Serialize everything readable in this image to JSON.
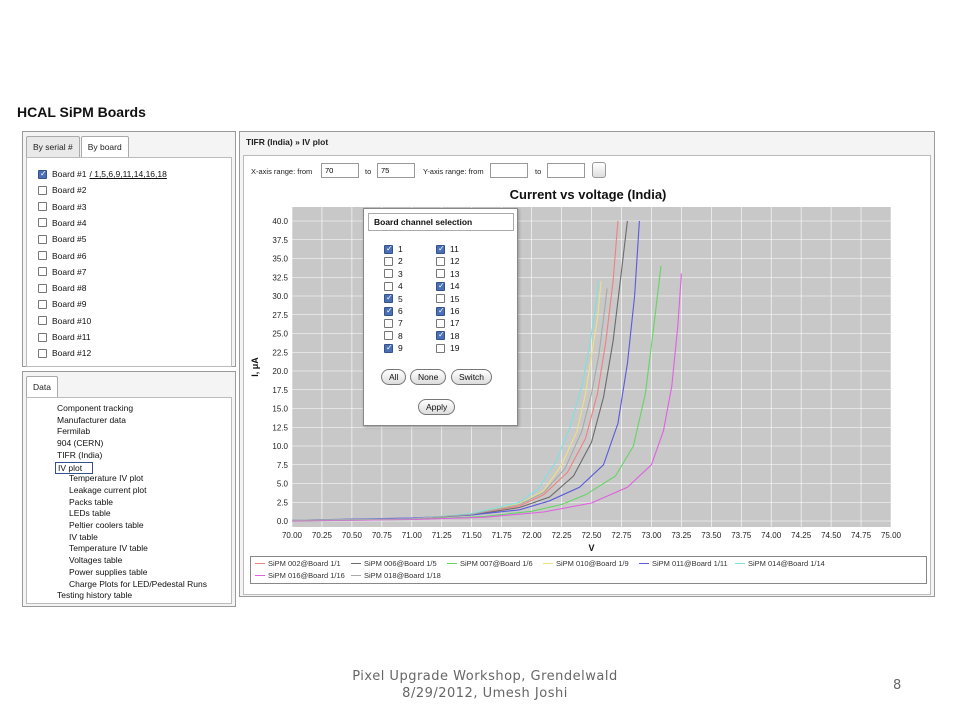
{
  "slide": {
    "title": "HCAL SiPM Boards",
    "footer_line1": "Pixel Upgrade Workshop, Grendelwald",
    "footer_line2": "8/29/2012, Umesh Joshi",
    "page_number": "8"
  },
  "left_top": {
    "tabs": [
      "By serial #",
      "By board"
    ],
    "boards": [
      {
        "label": "Board #1",
        "link": "/ 1,5,6,9,11,14,16,18",
        "checked": true
      },
      {
        "label": "Board #2",
        "checked": false
      },
      {
        "label": "Board #3",
        "checked": false
      },
      {
        "label": "Board #4",
        "checked": false
      },
      {
        "label": "Board #5",
        "checked": false
      },
      {
        "label": "Board #6",
        "checked": false
      },
      {
        "label": "Board #7",
        "checked": false
      },
      {
        "label": "Board #8",
        "checked": false
      },
      {
        "label": "Board #9",
        "checked": false
      },
      {
        "label": "Board #10",
        "checked": false
      },
      {
        "label": "Board #11",
        "checked": false
      },
      {
        "label": "Board #12",
        "checked": false
      }
    ]
  },
  "left_bottom": {
    "tab": "Data",
    "tree": [
      {
        "label": "Component tracking",
        "level": 0
      },
      {
        "label": "Manufacturer data",
        "level": 0
      },
      {
        "label": "Fermilab",
        "level": 0
      },
      {
        "label": "904 (CERN)",
        "level": 0
      },
      {
        "label": "TIFR (India)",
        "level": 0
      },
      {
        "label": "IV plot",
        "level": 1,
        "selected": true
      },
      {
        "label": "Temperature IV plot",
        "level": 1
      },
      {
        "label": "Leakage current plot",
        "level": 1
      },
      {
        "label": "Packs table",
        "level": 1
      },
      {
        "label": "LEDs table",
        "level": 1
      },
      {
        "label": "Peltier coolers table",
        "level": 1
      },
      {
        "label": "IV table",
        "level": 1
      },
      {
        "label": "Temperature IV table",
        "level": 1
      },
      {
        "label": "Voltages table",
        "level": 1
      },
      {
        "label": "Power supplies table",
        "level": 1
      },
      {
        "label": "Charge Plots for LED/Pedestal Runs",
        "level": 1
      },
      {
        "label": "Testing history table",
        "level": 0
      }
    ]
  },
  "right": {
    "breadcrumb": "TIFR (India) »  IV plot",
    "x_range_label": "X-axis range: from",
    "x_from": "70",
    "to_label": "to",
    "x_to": "75",
    "y_range_label": "Y-axis range: from",
    "y_from": "",
    "y_to": ""
  },
  "popup": {
    "title": "Board channel selection",
    "channels": [
      {
        "n": "1",
        "on": true
      },
      {
        "n": "2",
        "on": false
      },
      {
        "n": "3",
        "on": false
      },
      {
        "n": "4",
        "on": false
      },
      {
        "n": "5",
        "on": true
      },
      {
        "n": "6",
        "on": true
      },
      {
        "n": "7",
        "on": false
      },
      {
        "n": "8",
        "on": false
      },
      {
        "n": "9",
        "on": true
      },
      {
        "n": "11",
        "on": true
      },
      {
        "n": "12",
        "on": false
      },
      {
        "n": "13",
        "on": false
      },
      {
        "n": "14",
        "on": true
      },
      {
        "n": "15",
        "on": false
      },
      {
        "n": "16",
        "on": true
      },
      {
        "n": "17",
        "on": false
      },
      {
        "n": "18",
        "on": true
      },
      {
        "n": "19",
        "on": false
      }
    ],
    "buttons": [
      "All",
      "None",
      "Switch"
    ],
    "apply": "Apply"
  },
  "chart_data": {
    "type": "line",
    "title": "Current vs voltage (India)",
    "xlabel": "V",
    "ylabel": "I, μA",
    "xlim": [
      70.0,
      75.0
    ],
    "ylim": [
      0.0,
      40.0
    ],
    "x_ticks": [
      "70.00",
      "70.25",
      "70.50",
      "70.75",
      "71.00",
      "71.25",
      "71.50",
      "71.75",
      "72.00",
      "72.25",
      "72.50",
      "72.75",
      "73.00",
      "73.25",
      "73.50",
      "73.75",
      "74.00",
      "74.25",
      "74.50",
      "74.75",
      "75.00"
    ],
    "y_ticks": [
      "0.0",
      "2.5",
      "5.0",
      "7.5",
      "10.0",
      "12.5",
      "15.0",
      "17.5",
      "20.0",
      "22.5",
      "25.0",
      "27.5",
      "30.0",
      "32.5",
      "35.0",
      "37.5",
      "40.0"
    ],
    "grid": true,
    "legend_position": "bottom",
    "series": [
      {
        "name": "SiPM 002@Board 1/1",
        "color": "#f08080",
        "x": [
          70.0,
          71.0,
          71.5,
          71.9,
          72.1,
          72.3,
          72.45,
          72.55,
          72.62,
          72.68,
          72.72
        ],
        "y": [
          0.1,
          0.3,
          0.9,
          2.0,
          3.5,
          6.5,
          11.0,
          17.0,
          24.0,
          32.0,
          40.0
        ]
      },
      {
        "name": "SiPM 006@Board 1/5",
        "color": "#6b6b6b",
        "x": [
          70.0,
          71.0,
          71.5,
          71.9,
          72.15,
          72.35,
          72.5,
          72.6,
          72.68,
          72.74,
          72.8
        ],
        "y": [
          0.1,
          0.3,
          0.8,
          1.8,
          3.2,
          6.0,
          10.5,
          16.5,
          24.0,
          32.0,
          40.0
        ]
      },
      {
        "name": "SiPM 007@Board 1/6",
        "color": "#66d466",
        "x": [
          70.0,
          71.0,
          71.6,
          72.0,
          72.25,
          72.45,
          72.7,
          72.85,
          72.95,
          73.02,
          73.08
        ],
        "y": [
          0.0,
          0.2,
          0.6,
          1.3,
          2.2,
          3.5,
          6.0,
          10.0,
          17.0,
          26.0,
          34.0
        ]
      },
      {
        "name": "SiPM 010@Board 1/9",
        "color": "#f0e080",
        "x": [
          70.0,
          71.0,
          71.5,
          71.9,
          72.1,
          72.25,
          72.38,
          72.45,
          72.5,
          72.55,
          72.58
        ],
        "y": [
          0.1,
          0.3,
          1.0,
          2.3,
          4.0,
          7.5,
          12.0,
          17.0,
          22.0,
          27.0,
          32.0
        ]
      },
      {
        "name": "SiPM 011@Board 1/11",
        "color": "#5a5adc",
        "x": [
          70.0,
          71.0,
          71.5,
          71.9,
          72.15,
          72.4,
          72.6,
          72.72,
          72.8,
          72.86,
          72.9
        ],
        "y": [
          0.1,
          0.4,
          0.8,
          1.5,
          2.7,
          4.5,
          7.5,
          13.0,
          21.0,
          30.0,
          40.0
        ]
      },
      {
        "name": "SiPM 014@Board 1/14",
        "color": "#80e0e0",
        "x": [
          70.0,
          71.0,
          71.5,
          71.9,
          72.05,
          72.2,
          72.32,
          72.42,
          72.48,
          72.53,
          72.56
        ],
        "y": [
          0.1,
          0.3,
          1.0,
          2.5,
          4.2,
          7.8,
          12.5,
          18.0,
          23.0,
          28.0,
          32.0
        ]
      },
      {
        "name": "SiPM 016@Board 1/16",
        "color": "#e060e0",
        "x": [
          70.0,
          71.0,
          71.6,
          72.1,
          72.5,
          72.8,
          73.0,
          73.1,
          73.17,
          73.22,
          73.25
        ],
        "y": [
          0.0,
          0.2,
          0.5,
          1.2,
          2.4,
          4.5,
          7.5,
          12.0,
          18.0,
          26.0,
          33.0
        ]
      },
      {
        "name": "SiPM 018@Board 1/18",
        "color": "#a8a8a8",
        "x": [
          70.0,
          71.0,
          71.5,
          71.9,
          72.1,
          72.28,
          72.42,
          72.5,
          72.56,
          72.6,
          72.63
        ],
        "y": [
          0.1,
          0.3,
          0.9,
          2.2,
          3.8,
          7.0,
          12.0,
          17.0,
          22.0,
          27.0,
          31.0
        ]
      }
    ]
  }
}
